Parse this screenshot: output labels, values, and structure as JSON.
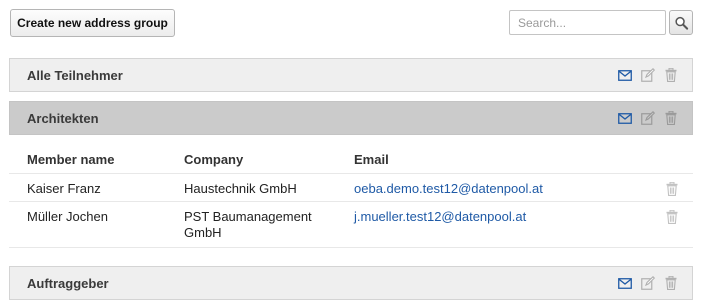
{
  "toolbar": {
    "create_group_label": "Create new address group",
    "search_placeholder": "Search...",
    "search_icon": "magnifier-icon"
  },
  "groups": [
    {
      "name": "Alle Teilnehmer",
      "state": "collapsed"
    },
    {
      "name": "Architekten",
      "state": "expanded"
    },
    {
      "name": "Auftraggeber",
      "state": "collapsed"
    }
  ],
  "group_action_icons": [
    "envelope-icon",
    "edit-icon",
    "trash-icon"
  ],
  "members_table": {
    "columns": [
      "Member name",
      "Company",
      "Email"
    ],
    "rows": [
      {
        "name": "Kaiser Franz",
        "company": "Haustechnik GmbH",
        "email": "oeba.demo.test12@datenpool.at"
      },
      {
        "name": "Müller Jochen",
        "company": "PST Baumanagement GmbH",
        "email": "j.mueller.test12@datenpool.at"
      }
    ]
  },
  "colors": {
    "accent_blue": "#1f5aa6",
    "icon_grey": "#b0b0b0",
    "expanded_header_bg": "#cbcbcb",
    "collapsed_header_bg": "#efefef"
  }
}
